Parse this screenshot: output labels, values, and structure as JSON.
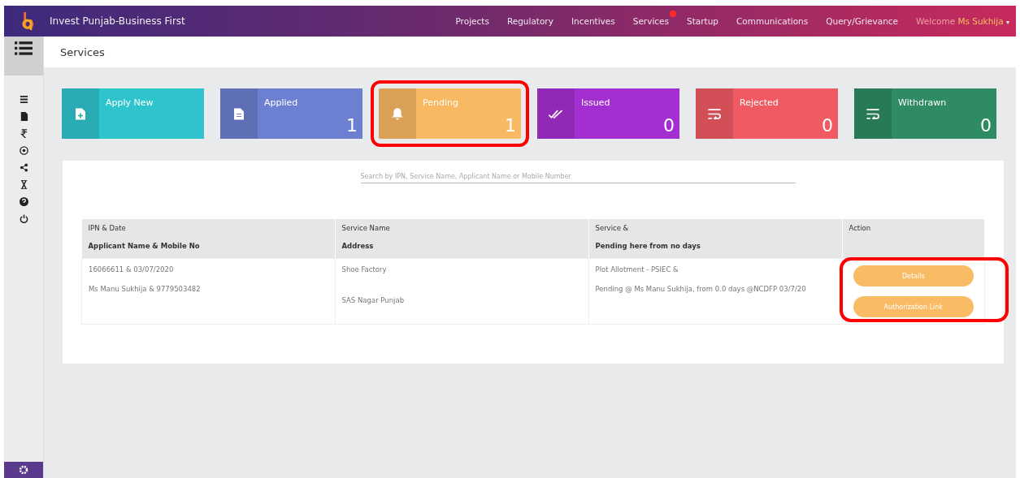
{
  "header": {
    "title": "Invest Punjab-Business First",
    "nav": [
      {
        "label": "Projects",
        "badge": false
      },
      {
        "label": "Regulatory",
        "badge": false
      },
      {
        "label": "Incentives",
        "badge": false
      },
      {
        "label": "Services",
        "badge": true
      },
      {
        "label": "Startup",
        "badge": false
      },
      {
        "label": "Communications",
        "badge": false
      },
      {
        "label": "Query/Grievance",
        "badge": false
      }
    ],
    "welcome": "Welcome",
    "user": "Ms Sukhija",
    "caret": "▾"
  },
  "sidebar": {
    "items": [
      {
        "kind": "menu"
      },
      {
        "kind": "document"
      },
      {
        "kind": "rupee"
      },
      {
        "kind": "circle"
      },
      {
        "kind": "share"
      },
      {
        "kind": "hourglass"
      },
      {
        "kind": "help"
      },
      {
        "kind": "power"
      }
    ]
  },
  "page_title": "Services",
  "cards": [
    {
      "label": "Apply New",
      "color": "#2fc3cc",
      "kind": "new",
      "highlighted": false
    },
    {
      "label": "Applied",
      "count": "1",
      "color": "#6c7fd0",
      "kind": "applied",
      "highlighted": false
    },
    {
      "label": "Pending",
      "count": "1",
      "color": "#f9b862",
      "kind": "pending",
      "highlighted": true
    },
    {
      "label": "Issued",
      "count": "0",
      "color": "#a42fd0",
      "kind": "issued",
      "highlighted": false
    },
    {
      "label": "Rejected",
      "count": "0",
      "color": "#ef5a63",
      "kind": "returned",
      "highlighted": false
    },
    {
      "label": "Withdrawn",
      "count": "0",
      "color": "#2e8b64",
      "kind": "returned",
      "highlighted": false
    }
  ],
  "search": {
    "placeholder": "Search by IPN, Service Name, Applicant Name or Mobile Number"
  },
  "table": {
    "columns": [
      {
        "line1": "IPN & Date",
        "line2": "Applicant Name & Mobile No"
      },
      {
        "line1": "Service Name",
        "line2": "Address"
      },
      {
        "line1": "Service &",
        "line2": "Pending here from no days"
      },
      {
        "line1": "Action"
      }
    ],
    "rows": [
      {
        "cells": [
          [
            "16066611 & 03/07/2020",
            "Ms Manu Sukhija & 9779503482"
          ],
          [
            "Shoe Factory",
            "SAS Nagar Punjab"
          ],
          [
            "Plot Allotment - PSIEC &",
            "Pending @ Ms Manu Sukhija, from 0.0 days @NCDFP 03/7/20"
          ]
        ],
        "actions": [
          "Details",
          "Authorization Link"
        ],
        "actions_highlighted": true
      }
    ]
  }
}
